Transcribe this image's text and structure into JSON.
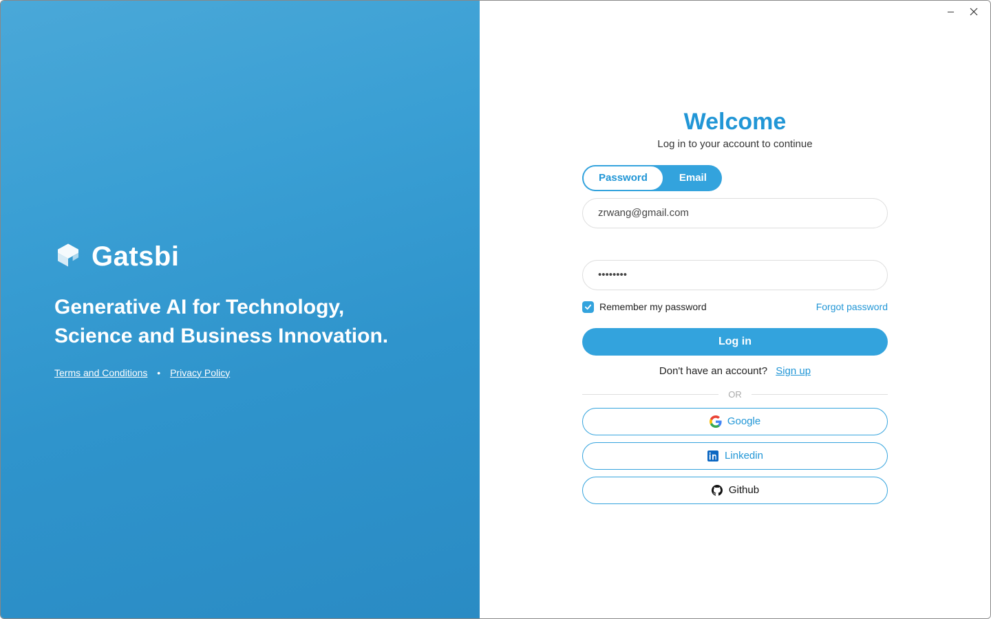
{
  "brand": {
    "name": "Gatsbi",
    "tagline": "Generative AI for Technology, Science and Business Innovation."
  },
  "legal": {
    "terms": "Terms and Conditions",
    "privacy": "Privacy Policy",
    "sep": "•"
  },
  "login": {
    "welcome": "Welcome",
    "subtitle": "Log in to your account to continue",
    "tabs": {
      "password": "Password",
      "email": "Email",
      "active": "Password"
    },
    "email_value": "zrwang@gmail.com",
    "password_value": "••••••••",
    "remember_label": "Remember my password",
    "remember_checked": true,
    "forgot_label": "Forgot password",
    "login_button": "Log in",
    "signup_prompt": "Don't have an account?",
    "signup_link": "Sign up",
    "or_label": "OR",
    "social": {
      "google": "Google",
      "linkedin": "Linkedin",
      "github": "Github"
    }
  },
  "colors": {
    "accent": "#33a3dd"
  }
}
